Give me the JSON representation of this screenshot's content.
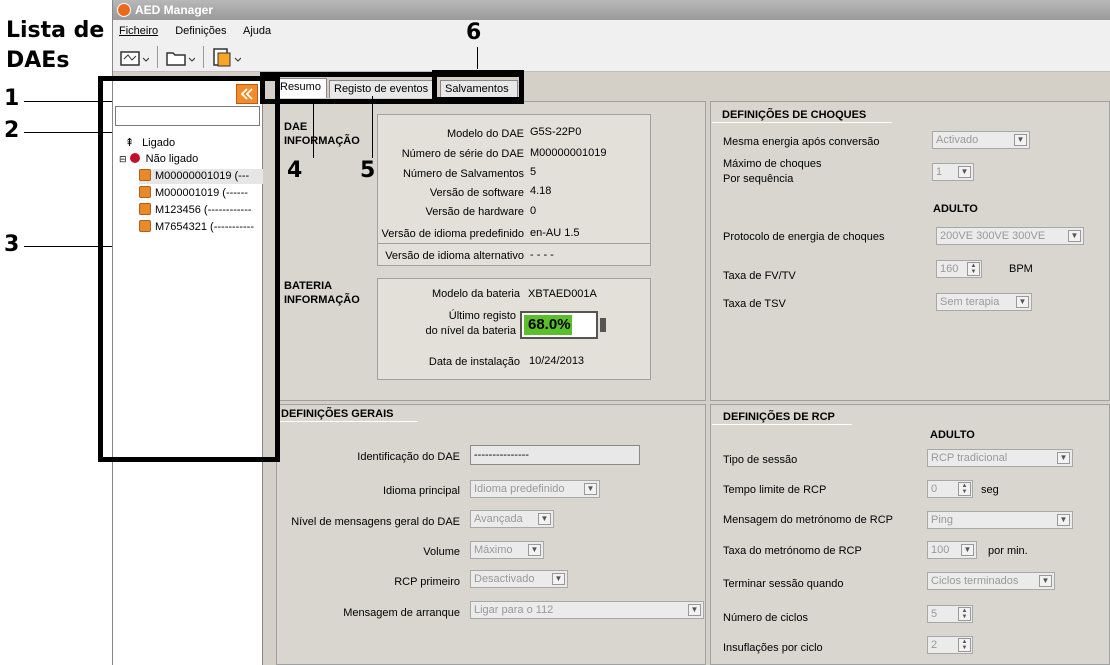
{
  "annotations": {
    "side_title": [
      "Lista de",
      "DAEs"
    ],
    "num1": "1",
    "num2": "2",
    "num3": "3",
    "num4": "4",
    "num5": "5",
    "num6": "6"
  },
  "window": {
    "title": "AED Manager"
  },
  "menu": [
    "Ficheiro",
    "Definições",
    "Ajuda"
  ],
  "tree": {
    "connected": "Ligado",
    "not_connected": "Não ligado",
    "items": [
      "M00000001019 (---",
      "M000001019 (------",
      "M123456 (------------",
      "M7654321 (-----------"
    ]
  },
  "tabs": [
    "Resumo",
    "Registo de eventos",
    "Salvamentos"
  ],
  "dae_info": {
    "heading": [
      "DAE",
      "INFORMAÇÃO"
    ],
    "rows": [
      {
        "label": "Modelo do DAE",
        "value": "G5S-22P0"
      },
      {
        "label": "Número de série do DAE",
        "value": "M00000001019"
      },
      {
        "label": "Número de Salvamentos",
        "value": "5"
      },
      {
        "label": "Versão de software",
        "value": "4.18"
      },
      {
        "label": "Versão de hardware",
        "value": "0"
      },
      {
        "label": "Versão de idioma predefinido",
        "value": "en-AU  1.5"
      },
      {
        "label": "Versão de idioma alternativo",
        "value": "- - - -"
      }
    ]
  },
  "battery_info": {
    "heading": [
      "BATERIA",
      "INFORMAÇÃO"
    ],
    "model_label": "Modelo da bateria",
    "model_value": "XBTAED001A",
    "level_label": [
      "Último registo",
      "do nível da bateria"
    ],
    "level_value": "68.0%",
    "level_fraction": 0.68,
    "install_label": "Data de instalação",
    "install_value": "10/24/2013"
  },
  "shock": {
    "heading": "DEFINIÇÕES DE CHOQUES",
    "same_energy_label": "Mesma energia após conversão",
    "same_energy_value": "Activado",
    "max_shocks_label": [
      "Máximo de choques",
      "Por sequência"
    ],
    "max_shocks_value": "1",
    "adult_label": "ADULTO",
    "protocol_label": "Protocolo de energia de choques",
    "protocol_value": "200VE 300VE 300VE",
    "fv_label": "Taxa de FV/TV",
    "fv_value": "160",
    "fv_unit": "BPM",
    "tsv_label": "Taxa de TSV",
    "tsv_value": "Sem terapia"
  },
  "general": {
    "heading": "DEFINIÇÕES GERAIS",
    "id_label": "Identificação do DAE",
    "id_value": "---------------",
    "lang_label": "Idioma principal",
    "lang_value": "Idioma predefinido",
    "msg_level_label": "Nível de mensagens geral do DAE",
    "msg_level_value": "Avançada",
    "volume_label": "Volume",
    "volume_value": "Máximo",
    "cpr_first_label": "RCP primeiro",
    "cpr_first_value": "Desactivado",
    "startup_label": "Mensagem de arranque",
    "startup_value": "Ligar para o 112"
  },
  "cpr": {
    "heading": "DEFINIÇÕES DE RCP",
    "adult_label": "ADULTO",
    "session_label": "Tipo de sessão",
    "session_value": "RCP tradicional",
    "timeout_label": "Tempo limite de RCP",
    "timeout_value": "0",
    "timeout_unit": "seg",
    "metronome_msg_label": "Mensagem do metrónomo de RCP",
    "metronome_msg_value": "Ping",
    "metronome_rate_label": "Taxa do metrónomo de RCP",
    "metronome_rate_value": "100",
    "metronome_rate_unit": "por min.",
    "end_label": "Terminar sessão quando",
    "end_value": "Ciclos terminados",
    "cycles_label": "Número de ciclos",
    "cycles_value": "5",
    "breaths_label": "Insuflações por ciclo",
    "breaths_value": "2"
  }
}
